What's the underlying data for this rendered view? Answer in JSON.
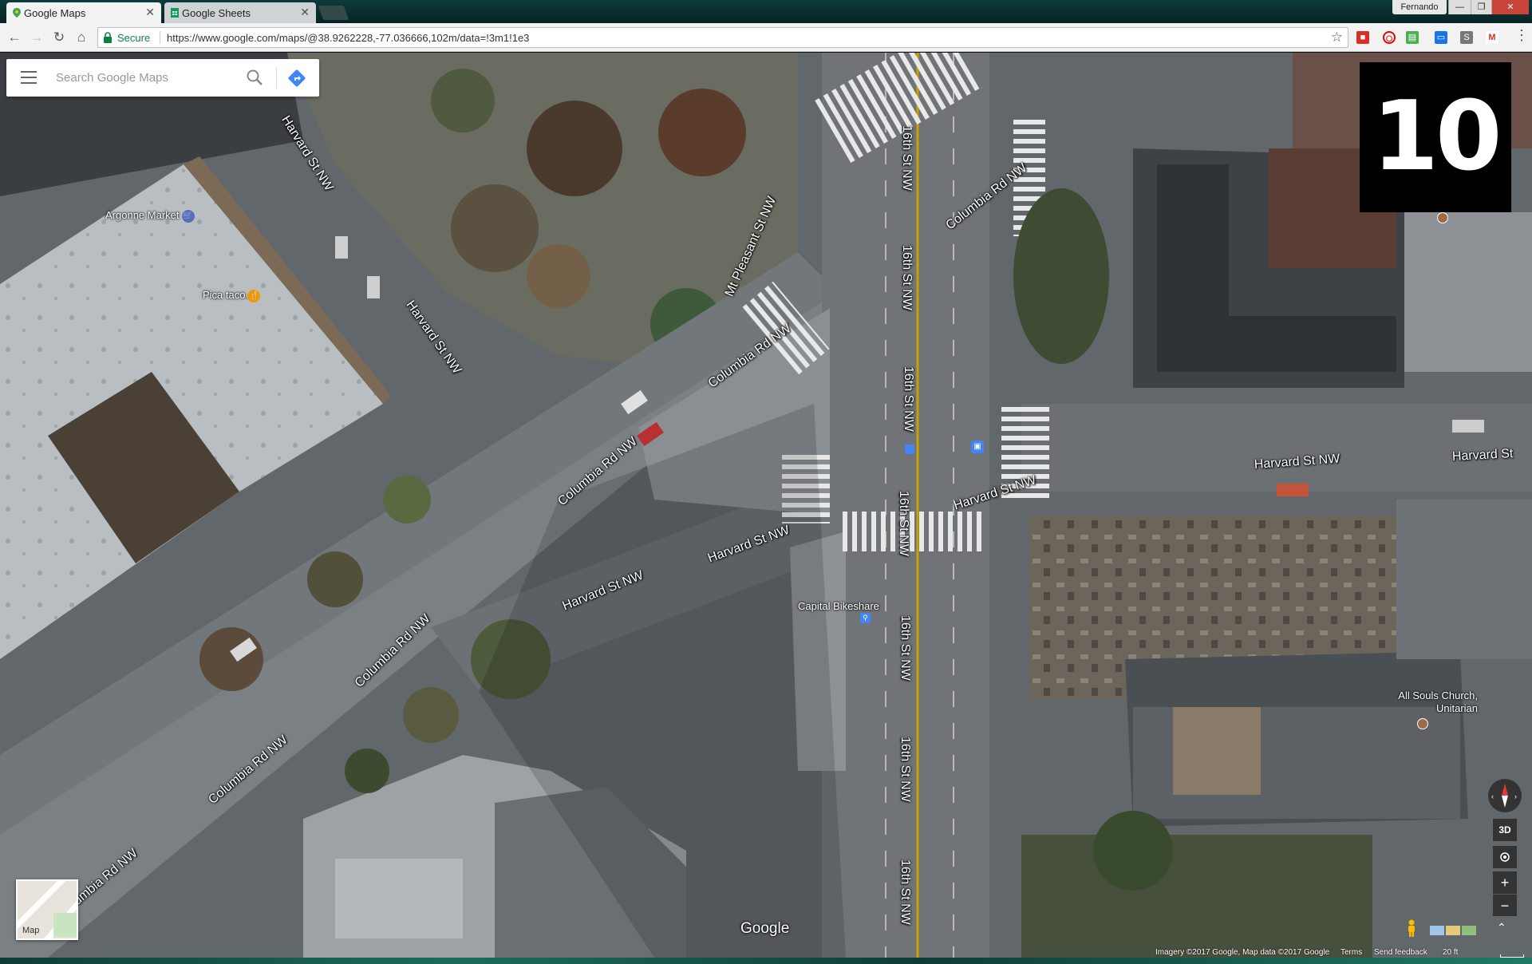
{
  "browser": {
    "tabs": [
      {
        "title": "Google Maps",
        "active": true
      },
      {
        "title": "Google Sheets",
        "active": false
      }
    ],
    "user": "Fernando",
    "window_controls": {
      "minimize": "—",
      "maximize": "❐",
      "close": "✕"
    },
    "nav": {
      "back": "←",
      "forward": "→",
      "reload": "↻",
      "home": "⌂"
    },
    "secure_label": "Secure",
    "url": "https://www.google.com/maps/@38.9262228,-77.036666,102m/data=!3m1!1e3",
    "star": "☆",
    "menu": "⋮"
  },
  "search": {
    "placeholder": "Search Google Maps"
  },
  "counter": "10",
  "road_labels": {
    "harvard_1": "Harvard St NW",
    "harvard_2": "Harvard St NW",
    "harvard_3": "Harvard St NW",
    "harvard_4": "Harvard St NW",
    "harvard_5": "Harvard St NW",
    "harvard_6": "Harvard St NW",
    "harvard_7": "Harvard St",
    "columbia_1": "Columbia Rd NW",
    "columbia_2": "Columbia Rd NW",
    "columbia_3": "Columbia Rd NW",
    "columbia_4": "Columbia Rd NW",
    "columbia_5": "Columbia Rd NW",
    "columbia_6": "Columbia Rd NW",
    "mtpleasant": "Mt Pleasant St NW",
    "sixteenth_1": "16th St NW",
    "sixteenth_2": "16th St NW",
    "sixteenth_3": "16th St NW",
    "sixteenth_4": "16th St NW",
    "sixteenth_5": "16th St NW",
    "sixteenth_6": "16th St NW",
    "sixteenth_7": "16th St NW"
  },
  "pois": {
    "argonne": "Argonne Market",
    "picataco": "Pica taco",
    "bikeshare": "Capital Bikeshare",
    "allsouls_1": "All Souls Church,",
    "allsouls_2": "Unitarian"
  },
  "map_controls": {
    "maptype_label": "Map",
    "three_d": "3D",
    "zoom_in": "+",
    "zoom_out": "−",
    "collapse": "⌃"
  },
  "logo": "Google",
  "footer": {
    "imagery": "Imagery ©2017 Google, Map data ©2017 Google",
    "terms": "Terms",
    "feedback": "Send feedback",
    "scale": "20 ft"
  },
  "colors": {
    "accent_blue": "#4285f4",
    "secure_green": "#0b8043",
    "poi_blue": "#5c6bc0",
    "poi_orange": "#f29900"
  }
}
